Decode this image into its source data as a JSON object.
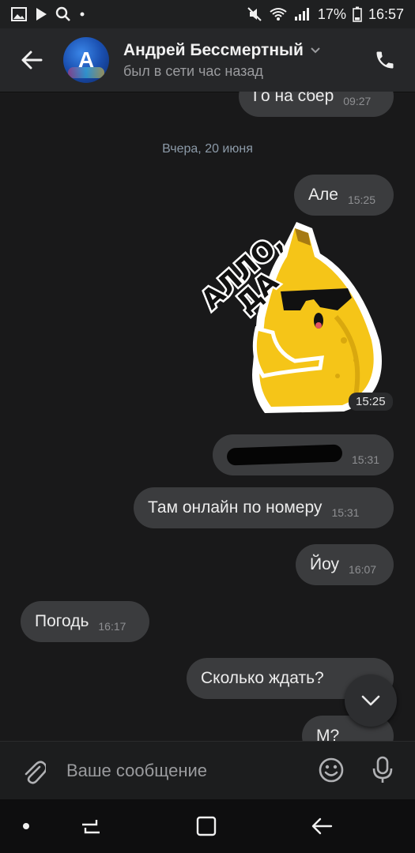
{
  "status_bar": {
    "battery": "17%",
    "time": "16:57"
  },
  "header": {
    "contact_name": "Андрей Бессмертный",
    "contact_status": "был в сети час назад",
    "avatar_letter": "A"
  },
  "messages": [
    {
      "text": "Го на сбер",
      "time": "09:27",
      "direction": "outgoing"
    },
    {
      "text": "Але",
      "time": "15:25",
      "direction": "outgoing"
    },
    {
      "text": "",
      "time": "15:31",
      "direction": "outgoing",
      "redacted": true
    },
    {
      "text": "Там онлайн по номеру",
      "time": "15:31",
      "direction": "outgoing"
    },
    {
      "text": "Йоу",
      "time": "16:07",
      "direction": "outgoing"
    },
    {
      "text": "Погодь",
      "time": "16:17",
      "direction": "incoming"
    },
    {
      "text": "Сколько ждать?",
      "time": "",
      "direction": "outgoing"
    },
    {
      "text": "М?",
      "time": "",
      "direction": "outgoing"
    }
  ],
  "date_separator": "Вчера, 20 июня",
  "sticker": {
    "time": "15:25",
    "caption_line1": "АЛЛО,",
    "caption_line2": "ДА"
  },
  "composer": {
    "placeholder": "Ваше сообщение"
  },
  "colors": {
    "bubble": "#3b3c3e",
    "background": "#19191a",
    "header": "#262729",
    "sticker_banana": "#f5c518"
  }
}
